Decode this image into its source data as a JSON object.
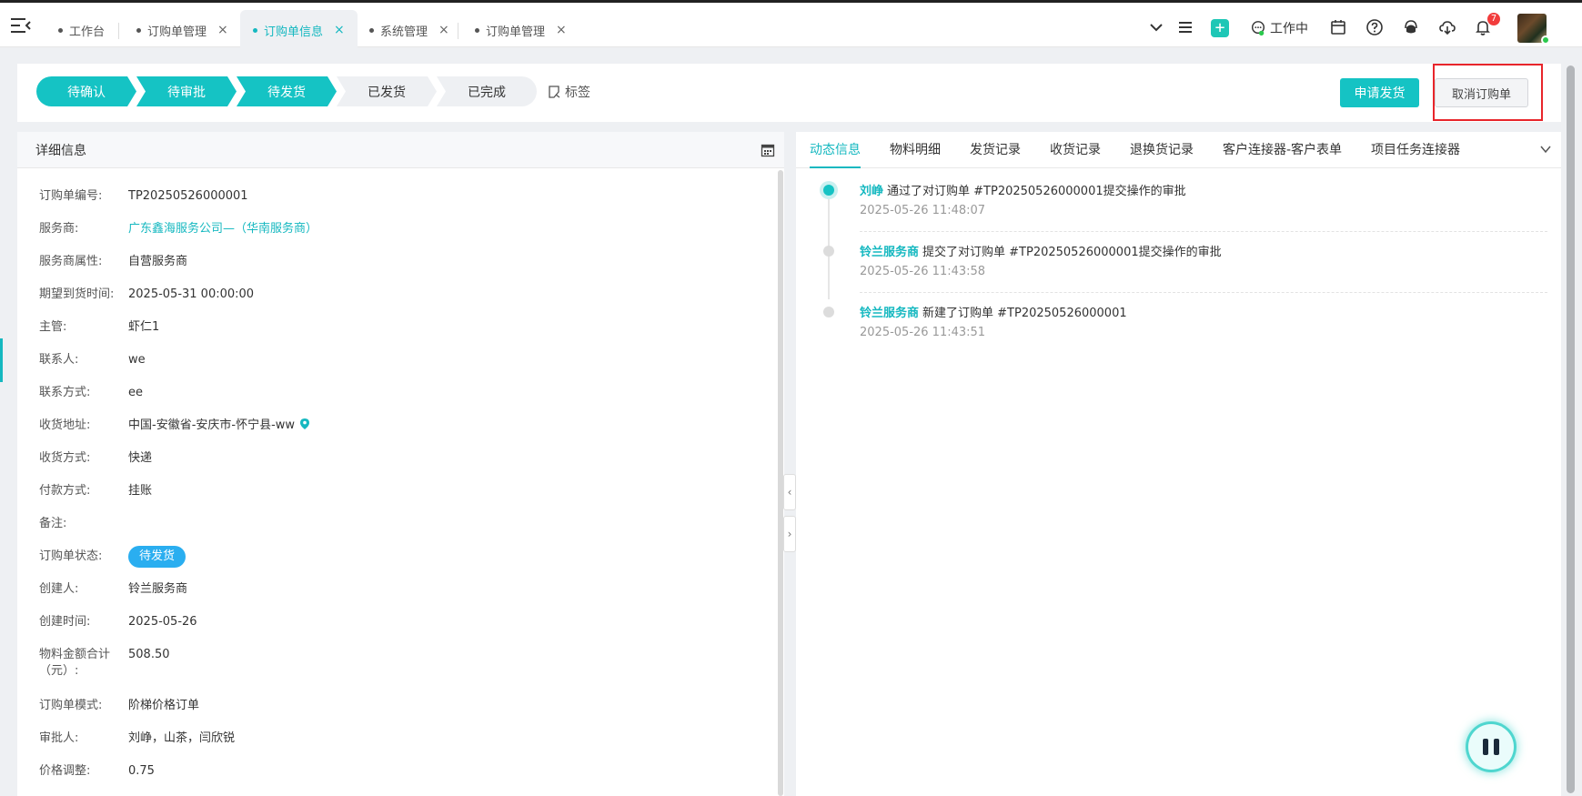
{
  "topbar": {
    "tabs": [
      {
        "label": "工作台",
        "closable": false,
        "active": false
      },
      {
        "label": "订购单管理",
        "closable": true,
        "active": false
      },
      {
        "label": "订购单信息",
        "closable": true,
        "active": true
      },
      {
        "label": "系统管理",
        "closable": true,
        "active": false
      },
      {
        "label": "订购单管理",
        "closable": true,
        "active": false
      }
    ],
    "close_glyph": "×",
    "work_status": "工作中",
    "notification_count": "7",
    "plus_glyph": "+"
  },
  "steps": {
    "items": [
      "待确认",
      "待审批",
      "待发货",
      "已发货",
      "已完成"
    ],
    "current_index": 2,
    "tag_label": "标签"
  },
  "actions": {
    "apply_ship": "申请发货",
    "cancel_order": "取消订购单"
  },
  "detail": {
    "title": "详细信息",
    "fields": [
      {
        "label": "订购单编号:",
        "value": "TP20250526000001"
      },
      {
        "label": "服务商:",
        "value": "广东鑫海服务公司—（华南服务商）"
      },
      {
        "label": "服务商属性:",
        "value": "自营服务商"
      },
      {
        "label": "期望到货时间:",
        "value": "2025-05-31 00:00:00"
      },
      {
        "label": "主管:",
        "value": "虾仁1"
      },
      {
        "label": "联系人:",
        "value": "we"
      },
      {
        "label": "联系方式:",
        "value": "ee"
      },
      {
        "label": "收货地址:",
        "value": "中国-安徽省-安庆市-怀宁县-ww"
      },
      {
        "label": "收货方式:",
        "value": "快递"
      },
      {
        "label": "付款方式:",
        "value": "挂账"
      },
      {
        "label": "备注:",
        "value": ""
      },
      {
        "label": "订购单状态:",
        "value": "待发货"
      },
      {
        "label": "创建人:",
        "value": "铃兰服务商"
      },
      {
        "label": "创建时间:",
        "value": "2025-05-26"
      },
      {
        "label": "物料金额合计（元）:",
        "value": "508.50"
      },
      {
        "label": "订购单模式:",
        "value": "阶梯价格订单"
      },
      {
        "label": "审批人:",
        "value": "刘峥，山茶，闫欣锐"
      },
      {
        "label": "价格调整:",
        "value": "0.75"
      }
    ]
  },
  "activity": {
    "tabs": [
      "动态信息",
      "物料明细",
      "发货记录",
      "收货记录",
      "退换货记录",
      "客户连接器-客户表单",
      "项目任务连接器"
    ],
    "active_tab": 0,
    "items": [
      {
        "actor": "刘峥",
        "text": "通过了对订购单 #TP20250526000001提交操作的审批",
        "time": "2025-05-26 11:48:07"
      },
      {
        "actor": "铃兰服务商",
        "text": "提交了对订购单 #TP20250526000001提交操作的审批",
        "time": "2025-05-26 11:43:58"
      },
      {
        "actor": "铃兰服务商",
        "text": "新建了订购单 #TP20250526000001",
        "time": "2025-05-26 11:43:51"
      }
    ]
  },
  "colors": {
    "accent": "#15c3c4",
    "link": "#15b8c0",
    "status_pill": "#2aaef0",
    "highlight": "#e8252b",
    "badge": "#f23c3c"
  }
}
